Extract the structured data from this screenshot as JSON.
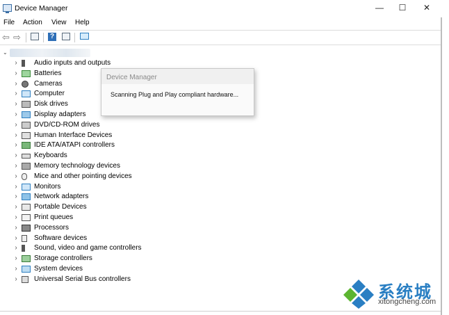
{
  "window": {
    "title": "Device Manager",
    "minimize_glyph": "—",
    "maximize_glyph": "☐",
    "close_glyph": "✕"
  },
  "menu": [
    "File",
    "Action",
    "View",
    "Help"
  ],
  "toolbar": {
    "back_glyph": "⇦",
    "forward_glyph": "⇨",
    "help_glyph": "?"
  },
  "tree": {
    "chevron": "›",
    "root_caret": "⌄",
    "categories": [
      {
        "label": "Audio inputs and outputs",
        "icon": "speaker-icon"
      },
      {
        "label": "Batteries",
        "icon": "battery-icon"
      },
      {
        "label": "Cameras",
        "icon": "camera-icon"
      },
      {
        "label": "Computer",
        "icon": "computer-icon"
      },
      {
        "label": "Disk drives",
        "icon": "disk-drive-icon"
      },
      {
        "label": "Display adapters",
        "icon": "display-adapter-icon"
      },
      {
        "label": "DVD/CD-ROM drives",
        "icon": "dvd-drive-icon"
      },
      {
        "label": "Human Interface Devices",
        "icon": "hid-icon"
      },
      {
        "label": "IDE ATA/ATAPI controllers",
        "icon": "ide-controller-icon"
      },
      {
        "label": "Keyboards",
        "icon": "keyboard-icon"
      },
      {
        "label": "Memory technology devices",
        "icon": "memory-icon"
      },
      {
        "label": "Mice and other pointing devices",
        "icon": "mouse-icon"
      },
      {
        "label": "Monitors",
        "icon": "monitor-icon"
      },
      {
        "label": "Network adapters",
        "icon": "network-adapter-icon"
      },
      {
        "label": "Portable Devices",
        "icon": "portable-device-icon"
      },
      {
        "label": "Print queues",
        "icon": "printer-icon"
      },
      {
        "label": "Processors",
        "icon": "processor-icon"
      },
      {
        "label": "Software devices",
        "icon": "software-device-icon"
      },
      {
        "label": "Sound, video and game controllers",
        "icon": "sound-controller-icon"
      },
      {
        "label": "Storage controllers",
        "icon": "storage-controller-icon"
      },
      {
        "label": "System devices",
        "icon": "system-device-icon"
      },
      {
        "label": "Universal Serial Bus controllers",
        "icon": "usb-icon"
      }
    ]
  },
  "popup": {
    "title": "Device Manager",
    "message": "Scanning Plug and Play compliant hardware..."
  },
  "watermark": {
    "cn": "系统城",
    "en": "xitongcheng.com"
  },
  "colors": {
    "accent": "#2e7fc0",
    "watermark_blue": "#2a7fc3",
    "watermark_green": "#5cb531"
  }
}
